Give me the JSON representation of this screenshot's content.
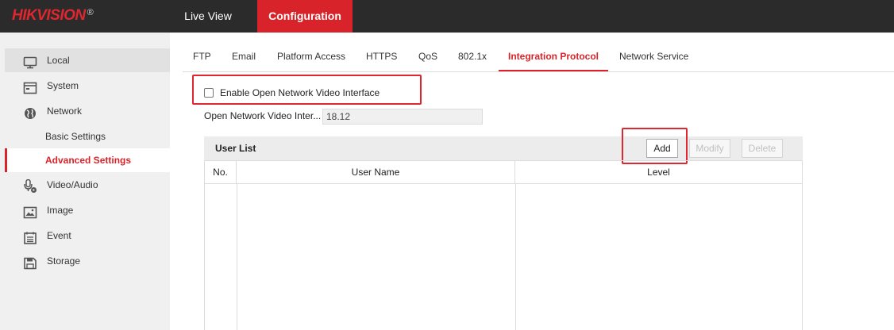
{
  "brand": {
    "name": "HIKVISION",
    "mark": "®"
  },
  "topnav": {
    "live_view": "Live View",
    "configuration": "Configuration"
  },
  "sidebar": {
    "items": [
      {
        "label": "Local",
        "icon": "monitor-icon"
      },
      {
        "label": "System",
        "icon": "system-icon"
      },
      {
        "label": "Network",
        "icon": "globe-icon"
      },
      {
        "label": "Basic Settings"
      },
      {
        "label": "Advanced Settings"
      },
      {
        "label": "Video/Audio",
        "icon": "microphone-camera-icon"
      },
      {
        "label": "Image",
        "icon": "image-icon"
      },
      {
        "label": "Event",
        "icon": "event-list-icon"
      },
      {
        "label": "Storage",
        "icon": "floppy-disk-icon"
      }
    ]
  },
  "tabs": [
    "FTP",
    "Email",
    "Platform Access",
    "HTTPS",
    "QoS",
    "802.1x",
    "Integration Protocol",
    "Network Service"
  ],
  "active_tab": "Integration Protocol",
  "form": {
    "enable_label": "Enable Open Network Video Interface",
    "enable_checked": false,
    "version_label": "Open Network Video Inter...",
    "version_value": "18.12"
  },
  "user_list": {
    "title": "User List",
    "add": "Add",
    "modify": "Modify",
    "delete": "Delete",
    "columns": [
      "No.",
      "User Name",
      "Level"
    ],
    "rows": []
  },
  "colors": {
    "accent": "#d8232a",
    "topbar": "#2b2b2b",
    "sidebar": "#f0f0f0"
  }
}
